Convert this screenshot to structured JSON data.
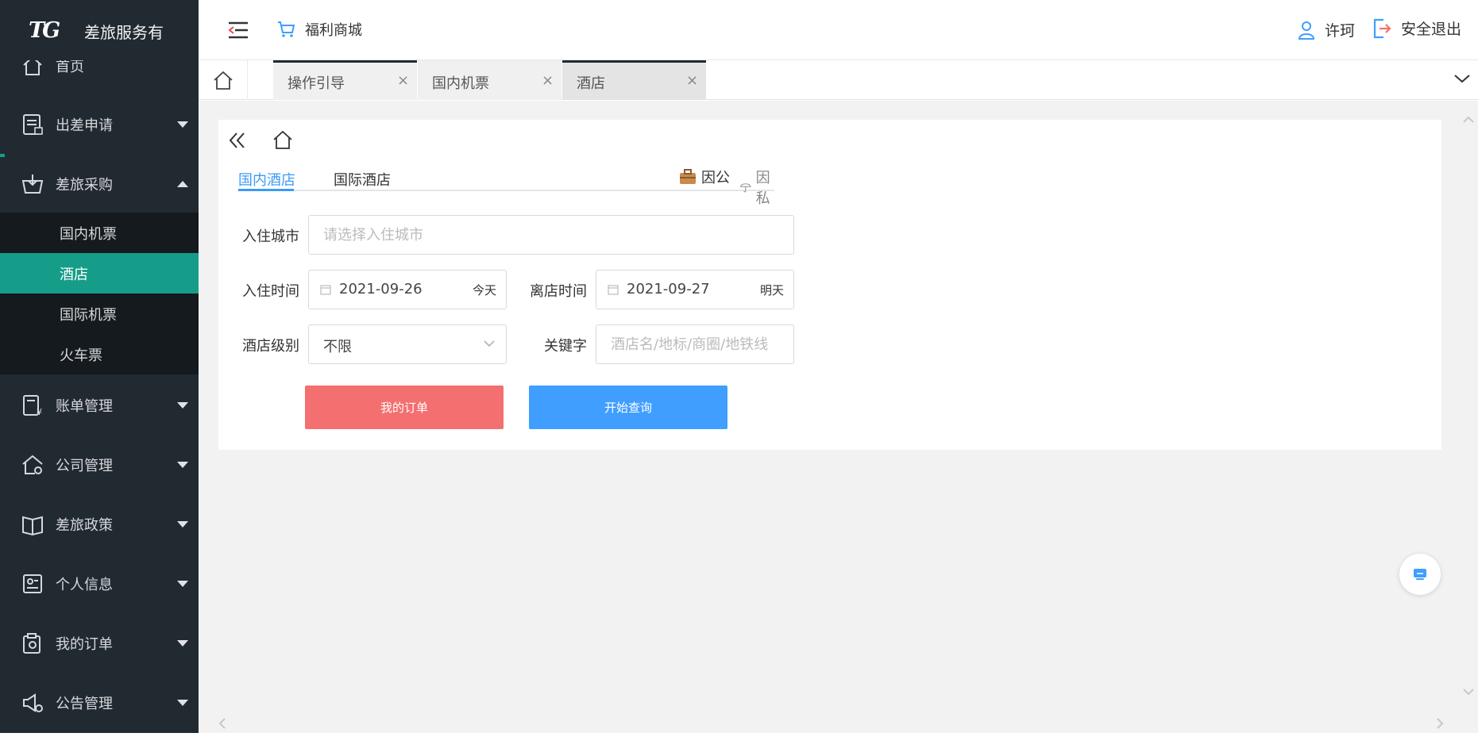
{
  "brand": {
    "name": "差旅服务有"
  },
  "sidebar": {
    "items": [
      {
        "label": "首页",
        "icon": "home-icon"
      },
      {
        "label": "出差申请",
        "icon": "application-icon"
      },
      {
        "label": "差旅采购",
        "icon": "purchase-basket-icon"
      },
      {
        "label": "账单管理",
        "icon": "bill-icon"
      },
      {
        "label": "公司管理",
        "icon": "company-icon"
      },
      {
        "label": "差旅政策",
        "icon": "policy-book-icon"
      },
      {
        "label": "个人信息",
        "icon": "id-card-icon"
      },
      {
        "label": "我的订单",
        "icon": "orders-icon"
      },
      {
        "label": "公告管理",
        "icon": "announcement-icon"
      }
    ],
    "submenu": [
      {
        "label": "国内机票"
      },
      {
        "label": "酒店"
      },
      {
        "label": "国际机票"
      },
      {
        "label": "火车票"
      }
    ],
    "active_sub": "酒店",
    "accent_color": "#169d8a"
  },
  "header": {
    "mall_label": "福利商城",
    "user_name": "许珂",
    "logout_label": "安全退出"
  },
  "tabs": [
    {
      "label": "操作引导",
      "close": "×"
    },
    {
      "label": "国内机票",
      "close": "×"
    },
    {
      "label": "酒店",
      "close": "×"
    }
  ],
  "hotel_search": {
    "tabs": {
      "domestic": "国内酒店",
      "international": "国际酒店"
    },
    "purpose": {
      "business": "因公",
      "personal": "因私"
    },
    "city": {
      "label": "入住城市",
      "placeholder": "请选择入住城市",
      "value": ""
    },
    "checkin": {
      "label": "入住时间",
      "date": "2021-09-26",
      "tag": "今天"
    },
    "checkout": {
      "label": "离店时间",
      "date": "2021-09-27",
      "tag": "明天"
    },
    "level": {
      "label": "酒店级别",
      "value": "不限"
    },
    "keyword": {
      "label": "关键字",
      "placeholder": "酒店名/地标/商圈/地铁线",
      "value": ""
    },
    "buttons": {
      "orders": "我的订单",
      "search": "开始查询"
    }
  },
  "colors": {
    "primary_blue": "#409eff",
    "orders_red": "#f46f6f",
    "sidebar_bg": "#222a31"
  }
}
